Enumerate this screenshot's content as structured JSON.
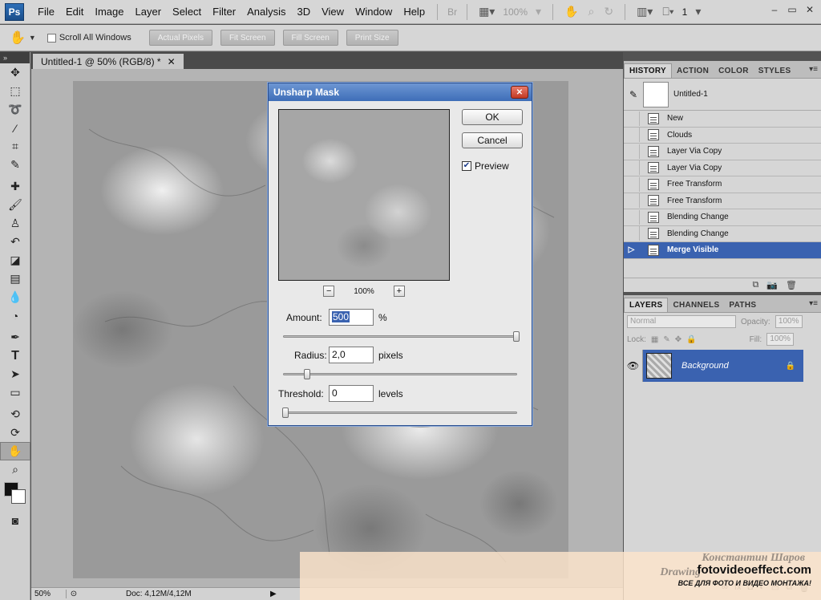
{
  "app": {
    "logo": "Ps"
  },
  "menu": [
    "File",
    "Edit",
    "Image",
    "Layer",
    "Select",
    "Filter",
    "Analysis",
    "3D",
    "View",
    "Window",
    "Help"
  ],
  "menubar": {
    "bridge": "Br",
    "zoom": "100%",
    "screen_mode": "1"
  },
  "options": {
    "scroll_all": "Scroll All Windows",
    "buttons": [
      "Actual Pixels",
      "Fit Screen",
      "Fill Screen",
      "Print Size"
    ]
  },
  "document": {
    "tab_title": "Untitled-1 @ 50% (RGB/8) *",
    "status_zoom": "50%",
    "status_doc": "Doc: 4,12M/4,12M"
  },
  "dialog": {
    "title": "Unsharp Mask",
    "ok": "OK",
    "cancel": "Cancel",
    "preview_label": "Preview",
    "preview_checked": true,
    "zoom": "100%",
    "amount_label": "Amount:",
    "amount_value": "500",
    "amount_unit": "%",
    "radius_label": "Radius:",
    "radius_value": "2,0",
    "radius_unit": "pixels",
    "threshold_label": "Threshold:",
    "threshold_value": "0",
    "threshold_unit": "levels"
  },
  "history": {
    "tabs": [
      "HISTORY",
      "ACTION",
      "COLOR",
      "STYLES"
    ],
    "snapshot": "Untitled-1",
    "items": [
      "New",
      "Clouds",
      "Layer Via Copy",
      "Layer Via Copy",
      "Free Transform",
      "Free Transform",
      "Blending Change",
      "Blending Change",
      "Merge Visible"
    ],
    "selected_index": 8
  },
  "layers": {
    "tabs": [
      "LAYERS",
      "CHANNELS",
      "PATHS"
    ],
    "blend_mode": "Normal",
    "opacity_label": "Opacity:",
    "opacity_value": "100%",
    "lock_label": "Lock:",
    "fill_label": "Fill:",
    "fill_value": "100%",
    "layer_name": "Background"
  },
  "watermark": {
    "author": "Константин Шаров",
    "subtitle": "Drawing",
    "site": "fotovideoeffect.com",
    "tagline": "ВСЕ ДЛЯ ФОТО И ВИДЕО МОНТАЖА!"
  }
}
